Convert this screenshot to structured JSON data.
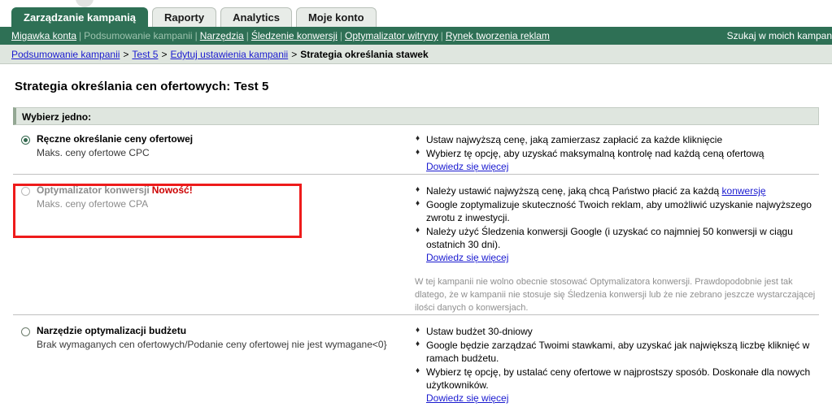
{
  "header": {
    "tabs": [
      {
        "label": "Zarządzanie kampanią",
        "active": true
      },
      {
        "label": "Raporty",
        "active": false
      },
      {
        "label": "Analytics",
        "active": false
      },
      {
        "label": "Moje konto",
        "active": false
      }
    ],
    "nav_links": [
      {
        "label": "Migawka konta",
        "current": false
      },
      {
        "label": "Podsumowanie kampanii",
        "current": true
      },
      {
        "label": "Narzędzia",
        "current": false
      },
      {
        "label": "Śledzenie konwersji",
        "current": false
      },
      {
        "label": "Optymalizator witryny",
        "current": false
      },
      {
        "label": "Rynek tworzenia reklam",
        "current": false
      }
    ],
    "nav_separator": "|",
    "search_label": "Szukaj w moich kampan"
  },
  "breadcrumb": {
    "items": [
      {
        "label": "Podsumowanie kampanii",
        "link": true
      },
      {
        "label": "Test 5",
        "link": true
      },
      {
        "label": "Edytuj ustawienia kampanii",
        "link": true
      },
      {
        "label": "Strategia określania stawek",
        "link": false
      }
    ],
    "separator": ">"
  },
  "main": {
    "page_title": "Strategia określania cen ofertowych: Test 5",
    "section_header": "Wybierz jedno:",
    "options": [
      {
        "id": "manual-cpc",
        "title": "Ręczne określanie ceny ofertowej",
        "badge": "",
        "subtitle": "Maks. ceny ofertowe CPC",
        "selected": true,
        "disabled": false,
        "bullets": [
          "Ustaw najwyższą cenę, jaką zamierzasz zapłacić za każde kliknięcie",
          "Wybierz tę opcję, aby uzyskać maksymalną kontrolę nad każdą ceną ofertową"
        ],
        "more_link": "Dowiedz się więcej",
        "note": ""
      },
      {
        "id": "conversion-optimizer",
        "title": "Optymalizator konwersji",
        "badge": "Nowość!",
        "subtitle": "Maks. ceny ofertowe CPA",
        "selected": false,
        "disabled": true,
        "bullets": [
          "Należy ustawić najwyższą cenę, jaką chcą Państwo płacić za każdą konwersję",
          "Google zoptymalizuje skuteczność Twoich reklam, aby umożliwić uzyskanie najwyższego zwrotu z inwestycji.",
          "Należy użyć Śledzenia konwersji Google (i uzyskać co najmniej 50 konwersji w ciągu ostatnich 30 dni)."
        ],
        "bullet_inline_link": "konwersję",
        "more_link": "Dowiedz się więcej",
        "note": "W tej kampanii nie wolno obecnie stosować Optymalizatora konwersji. Prawdopodobnie jest tak dlatego, że w kampanii nie stosuje się Śledzenia konwersji lub że nie zebrano jeszcze wystarczającej ilości danych o konwersjach."
      },
      {
        "id": "budget-optimizer",
        "title": "Narzędzie optymalizacji budżetu",
        "badge": "",
        "subtitle": "Brak wymaganych cen ofertowych/Podanie ceny ofertowej nie jest wymagane<0}",
        "selected": false,
        "disabled": false,
        "bullets": [
          "Ustaw budżet 30-dniowy",
          "Google będzie zarządzać Twoimi stawkami, aby uzyskać jak największą liczbę kliknięć w ramach budżetu.",
          "Wybierz tę opcję, by ustalać ceny ofertowe w najprostszy sposób. Doskonałe dla nowych użytkowników."
        ],
        "more_link": "Dowiedz się więcej",
        "note": ""
      }
    ]
  },
  "annotation": {
    "highlight_color": "#ee1b1b",
    "target_option": "conversion-optimizer"
  }
}
